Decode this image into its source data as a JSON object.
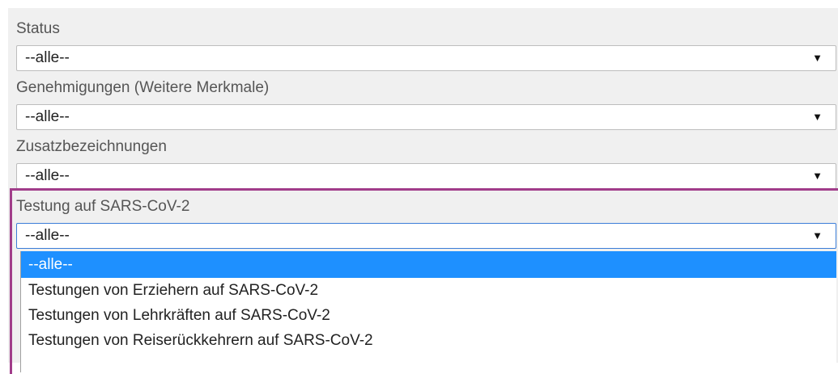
{
  "filters": [
    {
      "label": "Status",
      "value": "--alle--"
    },
    {
      "label": "Genehmigungen (Weitere Merkmale)",
      "value": "--alle--"
    },
    {
      "label": "Zusatzbezeichnungen",
      "value": "--alle--"
    },
    {
      "label": "Testung auf SARS-CoV-2",
      "value": "--alle--"
    }
  ],
  "dropdown": {
    "options": [
      "--alle--",
      "Testungen von Erziehern auf SARS-CoV-2",
      "Testungen von Lehrkräften auf SARS-CoV-2",
      "Testungen von Reiserückkehrern auf SARS-CoV-2"
    ],
    "selected_index": 0
  },
  "arrow_glyph": "▼",
  "colors": {
    "panel_bg": "#f0f0f0",
    "highlight_border": "#a13d8a",
    "selected_option_bg": "#1e90ff",
    "focus_border": "#3b7dd8"
  }
}
